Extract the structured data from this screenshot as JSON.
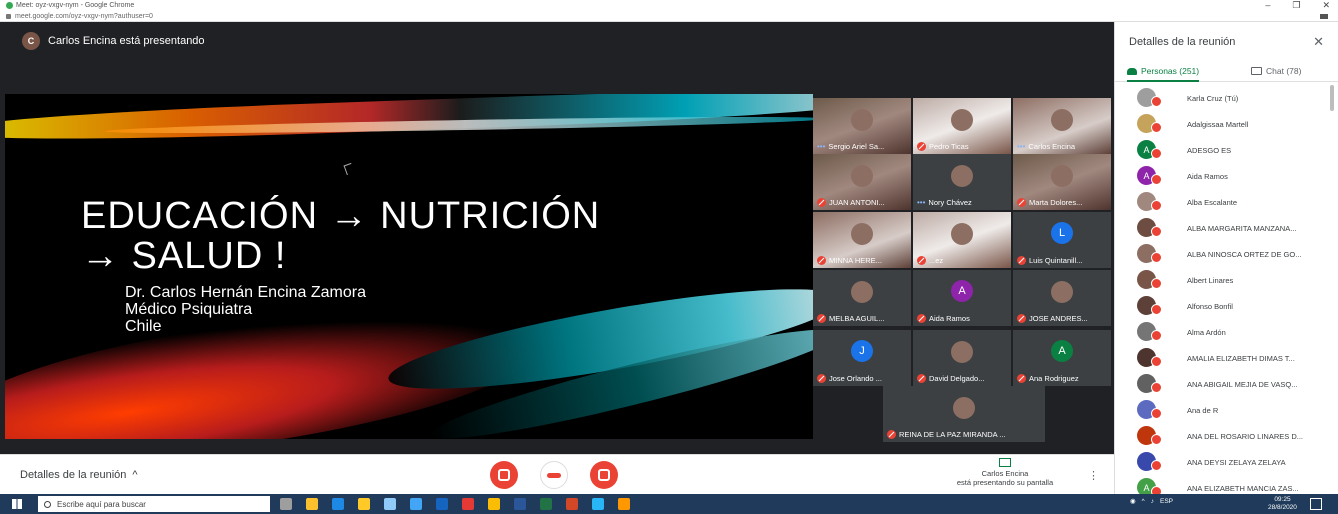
{
  "window": {
    "title": "Meet: oyz-vxgv-nym - Google Chrome",
    "url": "meet.google.com/oyz-vxgv-nym?authuser=0"
  },
  "presenter_banner": {
    "initial": "C",
    "text": "Carlos Encina está presentando"
  },
  "slide": {
    "title_line1": "EDUCACIÓN → NUTRICIÓN",
    "title_line2": "→ SALUD !",
    "author": "Dr. Carlos Hernán Encina Zamora",
    "role": "Médico Psiquiatra",
    "country": "Chile"
  },
  "tiles": [
    {
      "name": "Sergio Ariel Sa...",
      "kind": "photo",
      "indicator": "dots"
    },
    {
      "name": "Pedro Ticas",
      "kind": "photo3",
      "indicator": "mic"
    },
    {
      "name": "Carlos Encina",
      "kind": "photo2",
      "indicator": "dots"
    },
    {
      "name": "JUAN ANTONI...",
      "kind": "photo",
      "indicator": "mic"
    },
    {
      "name": "Nory Chávez",
      "kind": "dark",
      "indicator": "dots"
    },
    {
      "name": "Marta Dolores...",
      "kind": "photo",
      "indicator": "mic"
    },
    {
      "name": "MINNA HERE...",
      "kind": "photo2",
      "indicator": "mic"
    },
    {
      "name": "...ez",
      "kind": "photo3",
      "indicator": "mic"
    },
    {
      "name": "Luis Quintanill...",
      "kind": "letter",
      "letter": "L",
      "letter_color": "#1a73e8",
      "indicator": "mic"
    },
    {
      "name": "MELBA AGUIL...",
      "kind": "dark",
      "indicator": "mic"
    },
    {
      "name": "Aida Ramos",
      "kind": "letter",
      "letter": "A",
      "letter_color": "#8e24aa",
      "indicator": "mic"
    },
    {
      "name": "JOSE ANDRES...",
      "kind": "dark",
      "indicator": "mic"
    },
    {
      "name": "Jose Orlando ...",
      "kind": "letter",
      "letter": "J",
      "letter_color": "#1a73e8",
      "indicator": "mic"
    },
    {
      "name": "David Delgado...",
      "kind": "dark",
      "indicator": "mic"
    },
    {
      "name": "Ana Rodriguez",
      "kind": "letter",
      "letter": "A",
      "letter_color": "#0b8043",
      "indicator": "mic"
    },
    {
      "name": "REINA DE LA PAZ MIRANDA ...",
      "kind": "dark",
      "indicator": "mic"
    }
  ],
  "bottombar": {
    "details_label": "Detalles de la reunión",
    "present_name": "Carlos Encina",
    "present_text": "está presentando su pantalla"
  },
  "panel": {
    "title": "Detalles de la reunión",
    "close": "✕",
    "tab_people": "Personas (251)",
    "tab_chat": "Chat (78)",
    "people": [
      {
        "name": "Karla Cruz (Tú)",
        "color": "#9e9e9e",
        "initial": ""
      },
      {
        "name": "Adalgissaa Martell",
        "color": "#c5a35a",
        "initial": ""
      },
      {
        "name": "ADESGO ES",
        "color": "#0b8043",
        "initial": "A"
      },
      {
        "name": "Aida Ramos",
        "color": "#8e24aa",
        "initial": "A"
      },
      {
        "name": "Alba Escalante",
        "color": "#a1887f",
        "initial": ""
      },
      {
        "name": "ALBA MARGARITA MANZANA...",
        "color": "#6d4c41",
        "initial": ""
      },
      {
        "name": "ALBA NINOSCA ORTEZ DE GO...",
        "color": "#8d6e63",
        "initial": ""
      },
      {
        "name": "Albert Linares",
        "color": "#795548",
        "initial": ""
      },
      {
        "name": "Alfonso Bonfil",
        "color": "#5d4037",
        "initial": ""
      },
      {
        "name": "Alma Ardón",
        "color": "#757575",
        "initial": ""
      },
      {
        "name": "AMALIA ELIZABETH DIMAS T...",
        "color": "#4e342e",
        "initial": ""
      },
      {
        "name": "ANA ABIGAIL MEJIA DE VASQ...",
        "color": "#616161",
        "initial": ""
      },
      {
        "name": "Ana de R",
        "color": "#5c6bc0",
        "initial": ""
      },
      {
        "name": "ANA DEL ROSARIO LINARES D...",
        "color": "#bf360c",
        "initial": ""
      },
      {
        "name": "ANA DEYSI ZELAYA ZELAYA",
        "color": "#3949ab",
        "initial": ""
      },
      {
        "name": "ANA ELIZABETH MANCIA ZAS...",
        "color": "#43a047",
        "initial": "A"
      }
    ]
  },
  "taskbar": {
    "search_placeholder": "Escribe aquí para buscar",
    "lang": "ESP",
    "time": "09:25",
    "date": "28/8/2020"
  }
}
